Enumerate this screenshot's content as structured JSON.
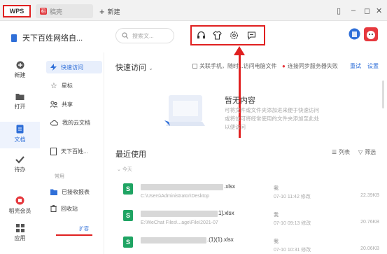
{
  "titlebar": {
    "app": "WPS",
    "tab_label": "稿壳",
    "new_tab": "新建"
  },
  "account": {
    "name": "天下百姓网络自..."
  },
  "search": {
    "placeholder": "搜索文..."
  },
  "sidebar": {
    "items": [
      {
        "label": "新建",
        "icon": "plus-circle-icon"
      },
      {
        "label": "打开",
        "icon": "folder-icon"
      },
      {
        "label": "文档",
        "icon": "document-icon"
      },
      {
        "label": "待办",
        "icon": "check-icon"
      },
      {
        "label": "稻壳会员",
        "icon": "docer-icon"
      },
      {
        "label": "应用",
        "icon": "grid-icon"
      }
    ]
  },
  "nav": {
    "items": [
      {
        "label": "快速访问"
      },
      {
        "label": "星标"
      },
      {
        "label": "共享"
      },
      {
        "label": "我的云文档"
      },
      {
        "label": "天下百姓..."
      }
    ],
    "section_label": "常用",
    "extra": [
      {
        "label": "已接收报表"
      },
      {
        "label": "回收站"
      }
    ],
    "expand": "扩容"
  },
  "main": {
    "quick_access_title": "快速访问",
    "link_phone": "关联手机，随时...访问电脑文件",
    "sync_fail": "连接同步服务器失败",
    "retry": "重试",
    "settings": "设置",
    "empty_title": "暂无内容",
    "empty_desc": "可将文件或文件夹添加进来便于快速访问或将位可将经常使用的文件夹添加至此处以便访问",
    "recent_title": "最近使用",
    "list_view": "列表",
    "filter": "筛选",
    "date_group": "今天",
    "files": [
      {
        "name": ".xlsx",
        "path": "C:\\Users\\Administrator\\Desktop",
        "owner": "我",
        "date": "07-10 11:42 修改",
        "size": "22.39KB"
      },
      {
        "name": "1].xlsx",
        "path": "E:\\WeChat Files\\...age\\File\\2021-07",
        "owner": "我",
        "date": "07-10 09:13 修改",
        "size": "20.76KB"
      },
      {
        "name": ".(1)(1).xlsx",
        "path": "",
        "owner": "我",
        "date": "07-10 10:31 修改",
        "size": "20.06KB"
      }
    ]
  },
  "colors": {
    "accent": "#2f6fd8",
    "highlight": "#e02020",
    "excel": "#1fa463"
  }
}
